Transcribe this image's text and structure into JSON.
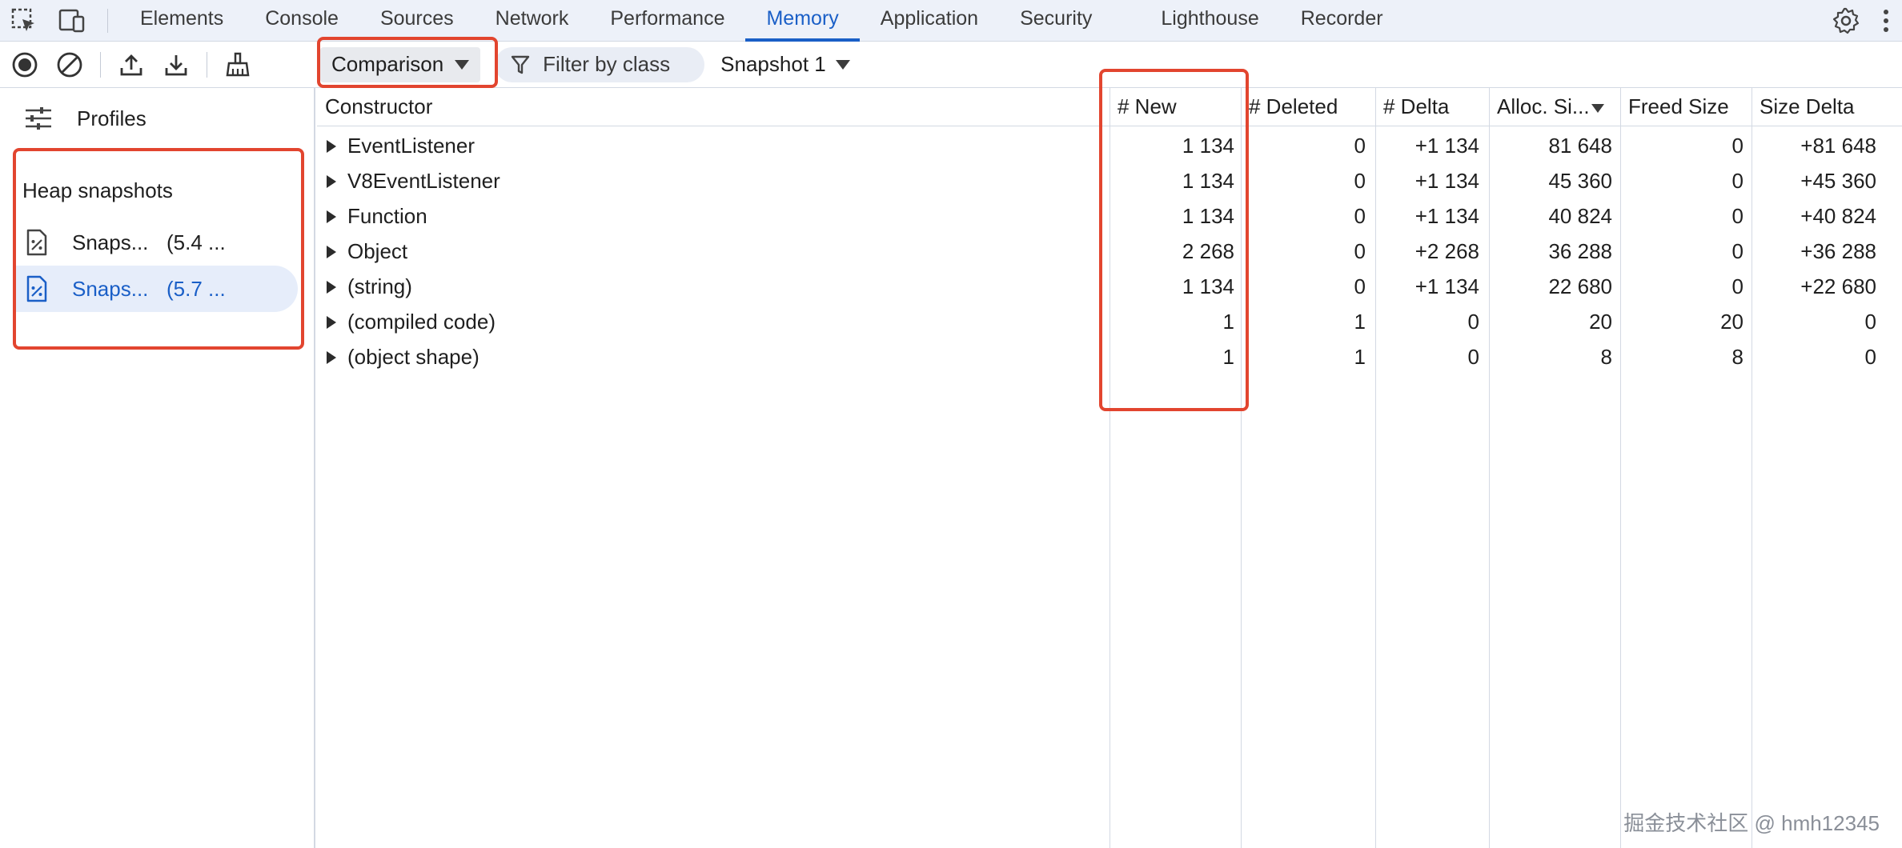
{
  "tabs": [
    {
      "label": "Elements"
    },
    {
      "label": "Console"
    },
    {
      "label": "Sources"
    },
    {
      "label": "Network"
    },
    {
      "label": "Performance"
    },
    {
      "label": "Memory",
      "active": true
    },
    {
      "label": "Application"
    },
    {
      "label": "Security"
    },
    {
      "label": "Lighthouse"
    },
    {
      "label": "Recorder"
    }
  ],
  "icons": {
    "inspect": "inspect-element-icon",
    "device": "device-toolbar-icon",
    "settings": "gear-icon",
    "more": "more-vertical-icon",
    "record": "record-icon",
    "clear": "clear-icon",
    "upload": "upload-icon",
    "download": "download-icon",
    "gc": "broom-icon",
    "filter": "filter-icon",
    "profiles": "sliders-icon",
    "snapshot": "heap-snapshot-icon"
  },
  "toolbar": {
    "view_select": "Comparison",
    "filter_placeholder": "Filter by class",
    "base_snapshot": "Snapshot 1"
  },
  "sidebar": {
    "profiles_label": "Profiles",
    "section_title": "Heap snapshots",
    "snapshots": [
      {
        "name": "Snaps...",
        "size": "(5.4 ..."
      },
      {
        "name": "Snaps...",
        "size": "(5.7 ...",
        "selected": true
      }
    ]
  },
  "table": {
    "headers": {
      "constructor": "Constructor",
      "new": "# New",
      "deleted": "# Deleted",
      "delta": "# Delta",
      "alloc": "Alloc. Si...",
      "freed": "Freed Size",
      "size_delta": "Size Delta"
    },
    "rows": [
      {
        "name": "EventListener",
        "new": "1 134",
        "deleted": "0",
        "delta": "+1 134",
        "alloc": "81 648",
        "freed": "0",
        "size_delta": "+81 648"
      },
      {
        "name": "V8EventListener",
        "new": "1 134",
        "deleted": "0",
        "delta": "+1 134",
        "alloc": "45 360",
        "freed": "0",
        "size_delta": "+45 360"
      },
      {
        "name": "Function",
        "new": "1 134",
        "deleted": "0",
        "delta": "+1 134",
        "alloc": "40 824",
        "freed": "0",
        "size_delta": "+40 824"
      },
      {
        "name": "Object",
        "new": "2 268",
        "deleted": "0",
        "delta": "+2 268",
        "alloc": "36 288",
        "freed": "0",
        "size_delta": "+36 288"
      },
      {
        "name": "(string)",
        "new": "1 134",
        "deleted": "0",
        "delta": "+1 134",
        "alloc": "22 680",
        "freed": "0",
        "size_delta": "+22 680"
      },
      {
        "name": "(compiled code)",
        "new": "1",
        "deleted": "1",
        "delta": "0",
        "alloc": "20",
        "freed": "20",
        "size_delta": "0"
      },
      {
        "name": "(object shape)",
        "new": "1",
        "deleted": "1",
        "delta": "0",
        "alloc": "8",
        "freed": "8",
        "size_delta": "0"
      }
    ]
  },
  "colors": {
    "accent": "#1a5fc7",
    "annotation": "#e2452f"
  },
  "watermark": "掘金技术社区 @ hmh12345"
}
